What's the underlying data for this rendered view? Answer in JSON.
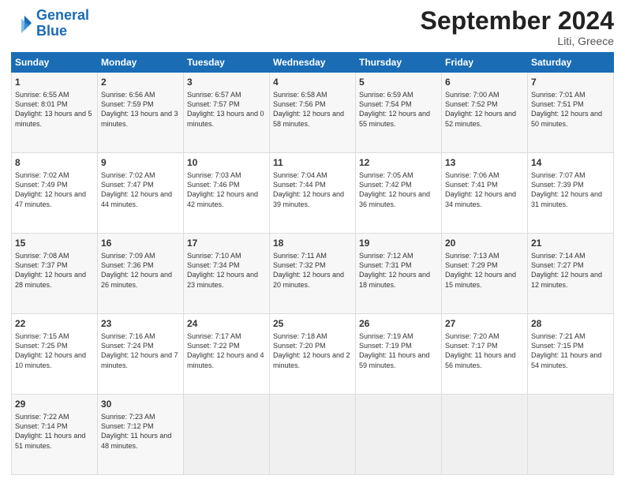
{
  "logo": {
    "line1": "General",
    "line2": "Blue"
  },
  "title": "September 2024",
  "location": "Liti, Greece",
  "days_of_week": [
    "Sunday",
    "Monday",
    "Tuesday",
    "Wednesday",
    "Thursday",
    "Friday",
    "Saturday"
  ],
  "weeks": [
    [
      {
        "num": "1",
        "rise": "6:55 AM",
        "set": "8:01 PM",
        "daylight": "13 hours and 5 minutes."
      },
      {
        "num": "2",
        "rise": "6:56 AM",
        "set": "7:59 PM",
        "daylight": "13 hours and 3 minutes."
      },
      {
        "num": "3",
        "rise": "6:57 AM",
        "set": "7:57 PM",
        "daylight": "13 hours and 0 minutes."
      },
      {
        "num": "4",
        "rise": "6:58 AM",
        "set": "7:56 PM",
        "daylight": "12 hours and 58 minutes."
      },
      {
        "num": "5",
        "rise": "6:59 AM",
        "set": "7:54 PM",
        "daylight": "12 hours and 55 minutes."
      },
      {
        "num": "6",
        "rise": "7:00 AM",
        "set": "7:52 PM",
        "daylight": "12 hours and 52 minutes."
      },
      {
        "num": "7",
        "rise": "7:01 AM",
        "set": "7:51 PM",
        "daylight": "12 hours and 50 minutes."
      }
    ],
    [
      {
        "num": "8",
        "rise": "7:02 AM",
        "set": "7:49 PM",
        "daylight": "12 hours and 47 minutes."
      },
      {
        "num": "9",
        "rise": "7:02 AM",
        "set": "7:47 PM",
        "daylight": "12 hours and 44 minutes."
      },
      {
        "num": "10",
        "rise": "7:03 AM",
        "set": "7:46 PM",
        "daylight": "12 hours and 42 minutes."
      },
      {
        "num": "11",
        "rise": "7:04 AM",
        "set": "7:44 PM",
        "daylight": "12 hours and 39 minutes."
      },
      {
        "num": "12",
        "rise": "7:05 AM",
        "set": "7:42 PM",
        "daylight": "12 hours and 36 minutes."
      },
      {
        "num": "13",
        "rise": "7:06 AM",
        "set": "7:41 PM",
        "daylight": "12 hours and 34 minutes."
      },
      {
        "num": "14",
        "rise": "7:07 AM",
        "set": "7:39 PM",
        "daylight": "12 hours and 31 minutes."
      }
    ],
    [
      {
        "num": "15",
        "rise": "7:08 AM",
        "set": "7:37 PM",
        "daylight": "12 hours and 28 minutes."
      },
      {
        "num": "16",
        "rise": "7:09 AM",
        "set": "7:36 PM",
        "daylight": "12 hours and 26 minutes."
      },
      {
        "num": "17",
        "rise": "7:10 AM",
        "set": "7:34 PM",
        "daylight": "12 hours and 23 minutes."
      },
      {
        "num": "18",
        "rise": "7:11 AM",
        "set": "7:32 PM",
        "daylight": "12 hours and 20 minutes."
      },
      {
        "num": "19",
        "rise": "7:12 AM",
        "set": "7:31 PM",
        "daylight": "12 hours and 18 minutes."
      },
      {
        "num": "20",
        "rise": "7:13 AM",
        "set": "7:29 PM",
        "daylight": "12 hours and 15 minutes."
      },
      {
        "num": "21",
        "rise": "7:14 AM",
        "set": "7:27 PM",
        "daylight": "12 hours and 12 minutes."
      }
    ],
    [
      {
        "num": "22",
        "rise": "7:15 AM",
        "set": "7:25 PM",
        "daylight": "12 hours and 10 minutes."
      },
      {
        "num": "23",
        "rise": "7:16 AM",
        "set": "7:24 PM",
        "daylight": "12 hours and 7 minutes."
      },
      {
        "num": "24",
        "rise": "7:17 AM",
        "set": "7:22 PM",
        "daylight": "12 hours and 4 minutes."
      },
      {
        "num": "25",
        "rise": "7:18 AM",
        "set": "7:20 PM",
        "daylight": "12 hours and 2 minutes."
      },
      {
        "num": "26",
        "rise": "7:19 AM",
        "set": "7:19 PM",
        "daylight": "11 hours and 59 minutes."
      },
      {
        "num": "27",
        "rise": "7:20 AM",
        "set": "7:17 PM",
        "daylight": "11 hours and 56 minutes."
      },
      {
        "num": "28",
        "rise": "7:21 AM",
        "set": "7:15 PM",
        "daylight": "11 hours and 54 minutes."
      }
    ],
    [
      {
        "num": "29",
        "rise": "7:22 AM",
        "set": "7:14 PM",
        "daylight": "11 hours and 51 minutes."
      },
      {
        "num": "30",
        "rise": "7:23 AM",
        "set": "7:12 PM",
        "daylight": "11 hours and 48 minutes."
      },
      null,
      null,
      null,
      null,
      null
    ]
  ]
}
